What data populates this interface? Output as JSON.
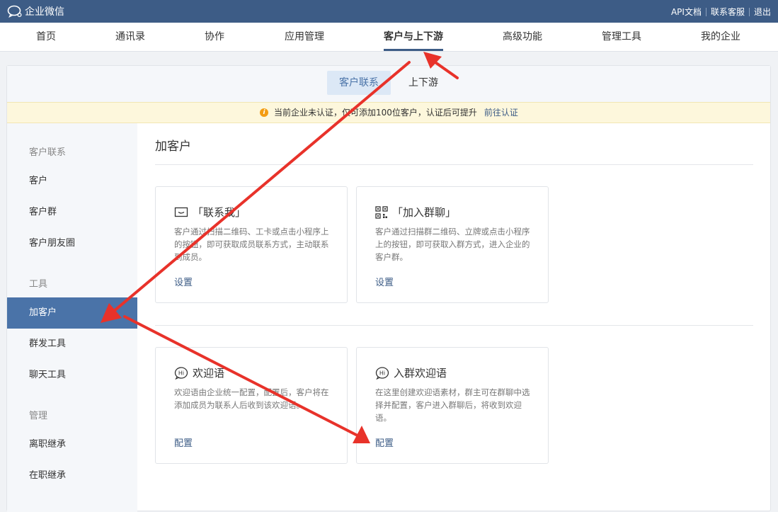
{
  "topbar": {
    "brand": "企业微信",
    "links": [
      "API文档",
      "联系客服",
      "退出"
    ]
  },
  "nav": {
    "items": [
      "首页",
      "通讯录",
      "协作",
      "应用管理",
      "客户与上下游",
      "高级功能",
      "管理工具",
      "我的企业"
    ],
    "active_index": 4
  },
  "subtabs": {
    "items": [
      "客户联系",
      "上下游"
    ],
    "active_index": 0
  },
  "notice": {
    "text": "当前企业未认证，仅可添加100位客户，认证后可提升",
    "link": "前往认证"
  },
  "sidebar": {
    "group1": "客户联系",
    "item_customer": "客户",
    "item_customer_group": "客户群",
    "item_moments": "客户朋友圈",
    "group2": "工具",
    "item_add_customer": "加客户",
    "item_mass_send": "群发工具",
    "item_chat_tool": "聊天工具",
    "group3": "管理",
    "item_resign_inherit": "离职继承",
    "item_onjob_inherit": "在职继承"
  },
  "main": {
    "title": "加客户",
    "cards": [
      {
        "title": "「联系我」",
        "desc": "客户通过扫描二维码、工卡或点击小程序上的按钮，即可获取成员联系方式，主动联系到成员。",
        "action": "设置",
        "icon": "contact-me-icon"
      },
      {
        "title": "「加入群聊」",
        "desc": "客户通过扫描群二维码、立牌或点击小程序上的按钮，即可获取入群方式，进入企业的客户群。",
        "action": "设置",
        "icon": "qrcode-icon"
      },
      {
        "title": "欢迎语",
        "desc": "欢迎语由企业统一配置，配置后，客户将在添加成员为联系人后收到该欢迎语。",
        "action": "配置",
        "icon": "hi-bubble-icon"
      },
      {
        "title": "入群欢迎语",
        "desc": "在这里创建欢迎语素材，群主可在群聊中选择并配置，客户进入群聊后，将收到欢迎语。",
        "action": "配置",
        "icon": "hi-bubble-icon"
      }
    ]
  },
  "colors": {
    "topbar": "#3d5c86",
    "accent": "#4a73a8",
    "arrow": "#e8322a",
    "notice_bg": "#fdf7dc",
    "warn": "#f39c12"
  }
}
